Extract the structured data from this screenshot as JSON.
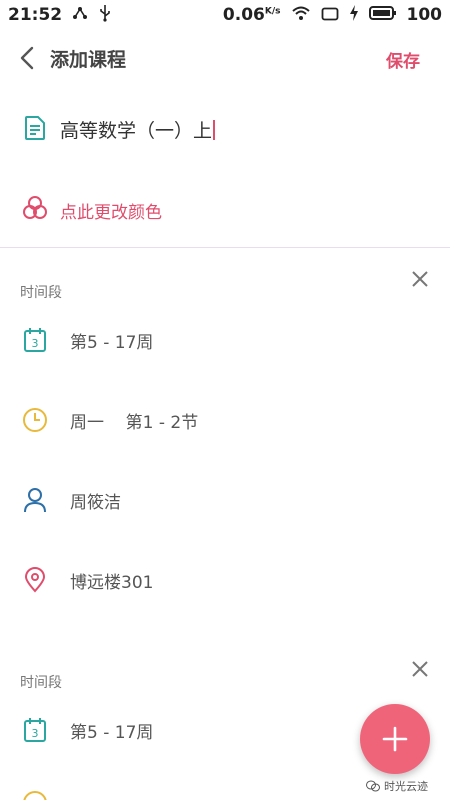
{
  "status_bar": {
    "time": "21:52",
    "speed": "0.06",
    "speed_unit": "K/s",
    "battery": "100"
  },
  "app_bar": {
    "title": "添加课程",
    "save_label": "保存"
  },
  "course": {
    "name_value": "高等数学（一）上",
    "color_label": "点此更改颜色"
  },
  "time_slots": [
    {
      "section_label": "时间段",
      "weeks": "第5 - 17周",
      "day_period": "周一    第1 - 2节",
      "teacher": "周筱洁",
      "location": "博远楼301"
    },
    {
      "section_label": "时间段",
      "weeks": "第5 - 17周"
    }
  ],
  "icons": {
    "calendar_number": "3"
  },
  "watermark": {
    "text": "时光云迹"
  },
  "colors": {
    "accent": "#e04d6c",
    "teal": "#2aa7a0",
    "yellow": "#e8b93a",
    "blue": "#2d6fa8",
    "fab": "#f0647a"
  }
}
